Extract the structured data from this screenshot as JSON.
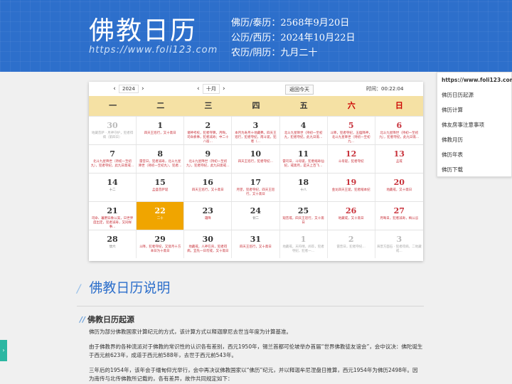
{
  "header": {
    "title": "佛教日历",
    "url": "https://www.foli123.com",
    "buddhist_date": "佛历/泰历：2568年9月20日",
    "gregorian_date": "公历/西历：2024年10月22日",
    "lunar_date": "农历/阴历：九月二十"
  },
  "toolbar": {
    "year": "2024",
    "month": "十月",
    "today_button": "返回今天",
    "time": "时间：00:22:04",
    "prev": "‹",
    "next": "›"
  },
  "weekdays": [
    "一",
    "二",
    "三",
    "四",
    "五",
    "六",
    "日"
  ],
  "weeks": [
    [
      {
        "n": "30",
        "note": "地藏菩萨 · 月神守护，犯者得病（第四日）",
        "style": "gray"
      },
      {
        "n": "1",
        "note": "四天王巡行，又十斋日"
      },
      {
        "n": "2",
        "note": "诸神考校，犯者夺算，月晦，司命奏事，犯者减寿；中二十八宿…"
      },
      {
        "n": "3",
        "note": "本月为寿月十地藏弗，四天王巡行，犯者夺纪，南斗诞，犯者（…"
      },
      {
        "n": "4",
        "note": "北斗九星降世（持初一至初九，犯者夺纪，此九日斋…"
      },
      {
        "n": "5",
        "note": "斗降，犯者夺纪，五瘟降神，北斗九星降世（持初一至初九…",
        "style": "red"
      },
      {
        "n": "6",
        "note": "北斗九星降世（持初一至初九），犯者夺纪，此九日斋…",
        "style": "red"
      }
    ],
    [
      {
        "n": "7",
        "note": "北斗九星降世（持初一至初九），犯者夺纪，此九日斋戒…"
      },
      {
        "n": "8",
        "note": "雷音日，犯者减寿，北斗九星降世（持初一至初九），犯者…"
      },
      {
        "n": "9",
        "note": "北斗九星降世（持初一至初九），犯者夺纪，此九日斋戒…"
      },
      {
        "n": "10",
        "note": "四天王巡行，犯者夺纪…"
      },
      {
        "n": "11",
        "note": "雷司日，斗母诞，犯者缩寿仙纪，戒斋月，是天上百飞…"
      },
      {
        "n": "12",
        "note": "斗母诞，犯者夺纪",
        "style": "red"
      },
      {
        "n": "13",
        "note": "孟戒",
        "style": "red"
      }
    ],
    [
      {
        "n": "14",
        "note": "十二",
        "dark": true
      },
      {
        "n": "15",
        "note": "孟盛菩萨诞"
      },
      {
        "n": "16",
        "note": "四天王巡行，又十斋日"
      },
      {
        "n": "17",
        "note": "月望，犯者夺纪，四天王巡行，又十斋日"
      },
      {
        "n": "18",
        "note": "十八",
        "dark": true
      },
      {
        "n": "19",
        "note": "金龙四天王诞，犯者缩本纪",
        "style": "red"
      },
      {
        "n": "20",
        "note": "地藏戒，又十斋日",
        "style": "red"
      }
    ],
    [
      {
        "n": "21",
        "note": "司命、暮野异象公案，日世界度出定，犯者减寿，又同样事…"
      },
      {
        "n": "22",
        "note": "二十",
        "today": true
      },
      {
        "n": "23",
        "note": "霜降"
      },
      {
        "n": "24",
        "note": "廿二",
        "dark": true
      },
      {
        "n": "25",
        "note": "观音戒，四天王巡行，又十斋日"
      },
      {
        "n": "26",
        "note": "地藏戒，又十斋日",
        "style": "red"
      },
      {
        "n": "27",
        "note": "月晦日，犯者减寿，梅公忌",
        "style": "red"
      }
    ],
    [
      {
        "n": "28",
        "note": "廿六",
        "dark": true
      },
      {
        "n": "29",
        "note": "斗降，犯者夺纪，又肾月十方本日为十斋日"
      },
      {
        "n": "30",
        "note": "地藏戒，人神在背，犯者得病，宜先一日勿戒，又十斋日"
      },
      {
        "n": "31",
        "note": "四天王巡行，又十斋日"
      },
      {
        "n": "1",
        "note": "地藏戒，天符晴，阅卒，犯者夺纪，犯者一…",
        "style": "gray"
      },
      {
        "n": "2",
        "note": "雷普日，犯者夺纪…",
        "style": "gray"
      },
      {
        "n": "3",
        "note": "海普方面石 · 犯者得病，二地藏戒…",
        "style": "gray"
      }
    ]
  ],
  "menu": {
    "items": [
      "https://www.foli123.com",
      "佛历日历起源",
      "佛历计算",
      "佛友房事注意事项",
      "佛教月历",
      "佛历年表",
      "佛历下载"
    ]
  },
  "article": {
    "section_title": "佛教日历说明",
    "sub_title": "佛教日历起源",
    "p1": "佛历为部分佛教国家计算纪元的方式，该计算方式以释迦摩尼去世当年度为计算基准。",
    "p2": "由于佛教界的各种流派对于佛教的常识性的认识各有差别，西元1950年，锡兰首都可伦坡举办首届“世界佛教徒友谊会”，会中议决：佛陀诞生于西元前623年，成道于西元前588年，去世于西元前543年。",
    "p3": "三年后的1954年，该年会于缅甸仰光举行，会中再决议佛教国家以“佛历”纪元，并以释迦牟尼涅盘日推算，西元1954年为佛历2498年。因为南传与北传佛教所记载的，各有差异，故作共同规定如下："
  },
  "side_tab": {
    "label": "›"
  }
}
